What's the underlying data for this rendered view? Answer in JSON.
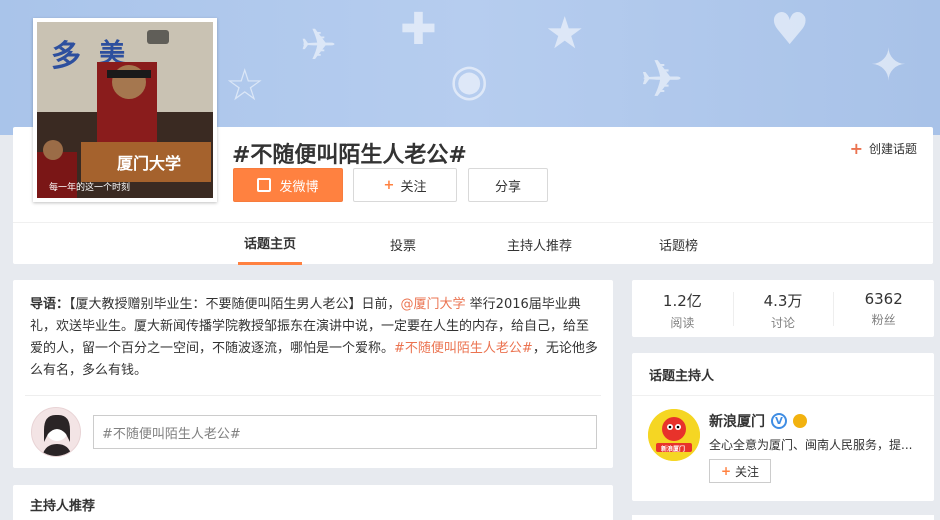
{
  "topic": {
    "title": "#不随便叫陌生人老公#",
    "create_label": "创建话题",
    "post_button": "发微博",
    "follow_button": "关注",
    "share_button": "分享",
    "cover_caption": "每一年的这一个时刻",
    "cover_podium_text": "厦门大学"
  },
  "tabs": [
    {
      "label": "话题主页",
      "active": true
    },
    {
      "label": "投票",
      "active": false
    },
    {
      "label": "主持人推荐",
      "active": false
    },
    {
      "label": "话题榜",
      "active": false
    }
  ],
  "intro": {
    "lead": "导语：",
    "part1": "【厦大教授赠别毕业生：不要随便叫陌生男人老公】日前，",
    "mention": "@厦门大学",
    "part2": " 举行2016届毕业典礼，欢送毕业生。厦大新闻传播学院教授邹振东在演讲中说，一定要在人生的内存，给自己，给至爱的人，留一个百分之一空间，不随波逐流，哪怕是一个爱称。",
    "hashtag": "#不随便叫陌生人老公#",
    "part3": "，无论他多么有名，多么有钱。"
  },
  "composer": {
    "placeholder": "#不随便叫陌生人老公#"
  },
  "host_recommend": {
    "title": "主持人推荐"
  },
  "stats": [
    {
      "value": "1.2亿",
      "label": "阅读"
    },
    {
      "value": "4.3万",
      "label": "讨论"
    },
    {
      "value": "6362",
      "label": "粉丝"
    }
  ],
  "host": {
    "section_title": "话题主持人",
    "name": "新浪厦门",
    "verified_mark": "V",
    "description": "全心全意为厦门、闽南人民服务，提...",
    "follow_label": "关注",
    "logo_text": "新浪厦门"
  },
  "colors": {
    "accent": "#ff8140",
    "link": "#eb7350",
    "banner": "#b6cdef"
  }
}
